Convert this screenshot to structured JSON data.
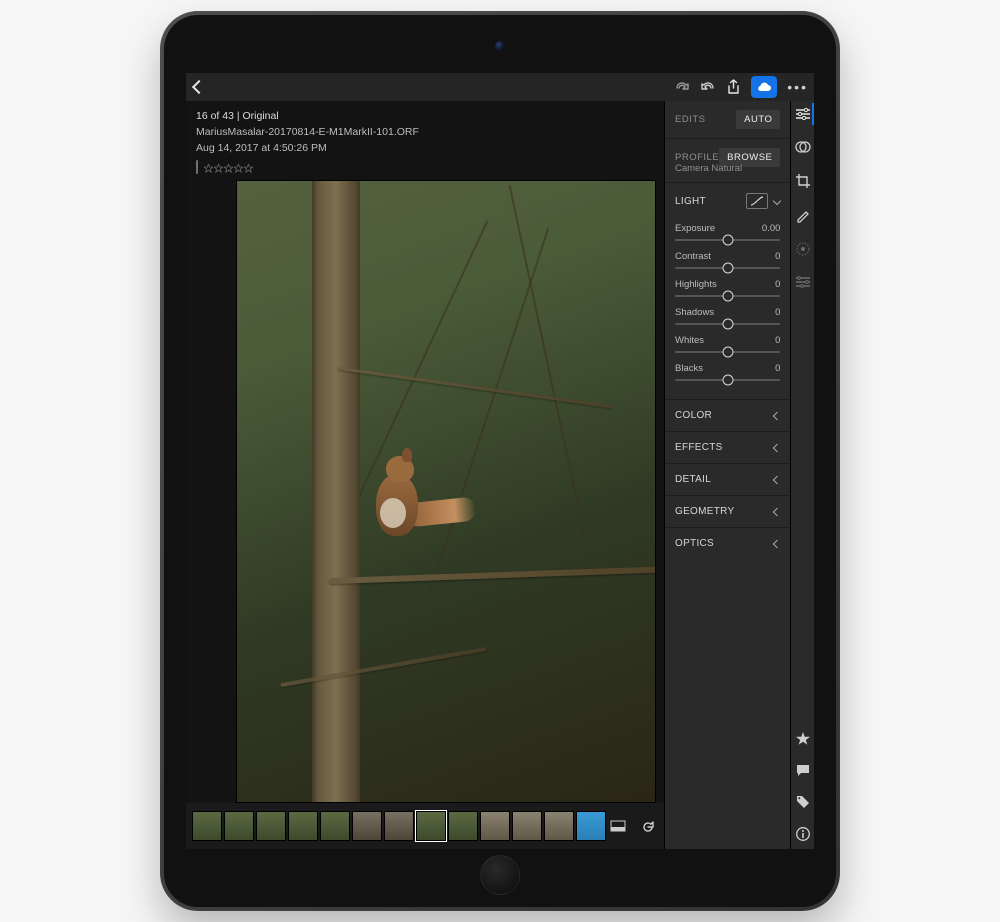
{
  "meta": {
    "counter": "16 of 43 | Original",
    "filename": "MariusMasalar-20170814-E-M1MarkII-101.ORF",
    "timestamp": "Aug 14, 2017 at 4:50:26 PM",
    "rating": 0
  },
  "panel": {
    "edits_label": "EDITS",
    "auto_label": "AUTO",
    "profile_label": "PROFILE",
    "browse_label": "BROWSE",
    "profile_name": "Camera Natural",
    "light_label": "LIGHT",
    "sliders": [
      {
        "label": "Exposure",
        "value": "0.00",
        "pos": 50
      },
      {
        "label": "Contrast",
        "value": "0",
        "pos": 50
      },
      {
        "label": "Highlights",
        "value": "0",
        "pos": 50
      },
      {
        "label": "Shadows",
        "value": "0",
        "pos": 50
      },
      {
        "label": "Whites",
        "value": "0",
        "pos": 50
      },
      {
        "label": "Blacks",
        "value": "0",
        "pos": 50
      }
    ],
    "sections": {
      "color": "COLOR",
      "effects": "EFFECTS",
      "detail": "DETAIL",
      "geometry": "GEOMETRY",
      "optics": "OPTICS"
    }
  }
}
